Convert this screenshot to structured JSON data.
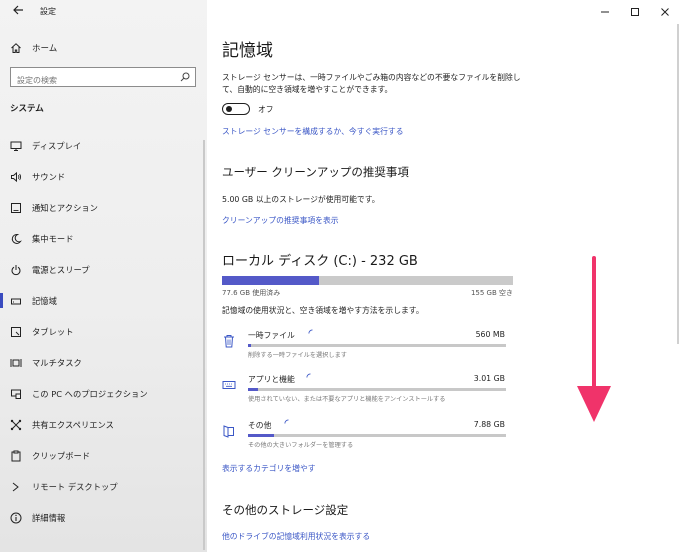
{
  "window": {
    "title": "設定"
  },
  "sidebar": {
    "home_label": "ホーム",
    "search_placeholder": "設定の検索",
    "section_label": "システム",
    "items": [
      {
        "label": "ディスプレイ",
        "icon": "display-icon"
      },
      {
        "label": "サウンド",
        "icon": "speaker-icon"
      },
      {
        "label": "通知とアクション",
        "icon": "notification-icon"
      },
      {
        "label": "集中モード",
        "icon": "moon-icon"
      },
      {
        "label": "電源とスリープ",
        "icon": "power-icon"
      },
      {
        "label": "記憶域",
        "icon": "storage-icon",
        "active": true
      },
      {
        "label": "タブレット",
        "icon": "tablet-icon"
      },
      {
        "label": "マルチタスク",
        "icon": "multitask-icon"
      },
      {
        "label": "この PC へのプロジェクション",
        "icon": "projection-icon"
      },
      {
        "label": "共有エクスペリエンス",
        "icon": "share-icon"
      },
      {
        "label": "クリップボード",
        "icon": "clipboard-icon"
      },
      {
        "label": "リモート デスクトップ",
        "icon": "remote-desktop-icon"
      },
      {
        "label": "詳細情報",
        "icon": "info-icon"
      }
    ]
  },
  "main": {
    "title": "記憶域",
    "sense_description_line1": "ストレージ センサーは、一時ファイルやごみ箱の内容などの不要なファイルを削除し",
    "sense_description_line2": "て、自動的に空き領域を増やすことができます。",
    "sense_toggle_label": "オフ",
    "sense_toggle_on": false,
    "sense_link": "ストレージ センサーを構成するか、今すぐ実行する",
    "cleanup_heading": "ユーザー クリーンアップの推奨事項",
    "cleanup_text": "5.00 GB 以上のストレージが使用可能です。",
    "cleanup_link": "クリーンアップの推奨事項を表示",
    "disk_heading": "ローカル ディスク (C:) - 232 GB",
    "disk_used_label": "77.6 GB 使用済み",
    "disk_free_label": "155 GB 空き",
    "disk_used_fraction": 0.334,
    "disk_hint": "記憶域の使用状況と、空き領域を増やす方法を示します。",
    "categories": [
      {
        "name": "一時ファイル",
        "size": "560 MB",
        "desc": "削除する一時ファイルを選択します",
        "icon": "trash-icon",
        "fraction": 0.008
      },
      {
        "name": "アプリと機能",
        "size": "3.01 GB",
        "desc": "使用されていない、または不要なアプリと機能をアンインストールする",
        "icon": "keyboard-icon",
        "fraction": 0.04
      },
      {
        "name": "その他",
        "size": "7.88 GB",
        "desc": "その他の大きいフォルダーを管理する",
        "icon": "folder-icon",
        "fraction": 0.1
      }
    ],
    "more_categories_link": "表示するカテゴリを増やす",
    "other_heading": "その他のストレージ設定",
    "other_link": "他のドライブの記憶域利用状況を表示する"
  },
  "colors": {
    "accent": "#5459c8",
    "link": "#3b57c6",
    "annotation_arrow": "#f0336a"
  }
}
